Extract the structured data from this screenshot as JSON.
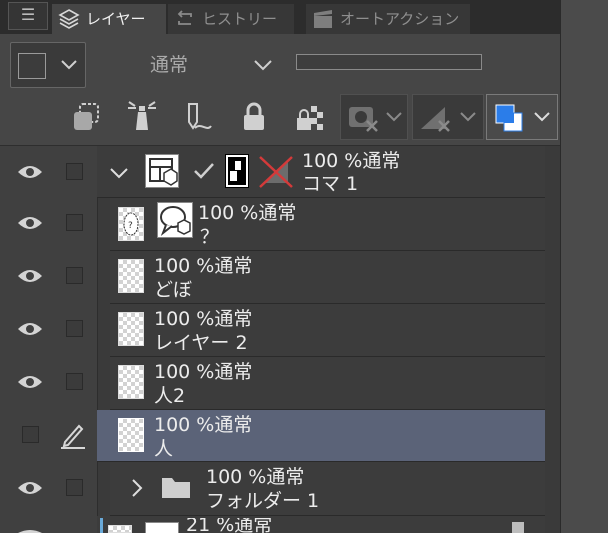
{
  "tabs": [
    {
      "label": "レイヤー",
      "icon": "layers-icon"
    },
    {
      "label": "ヒストリー",
      "icon": "history-icon"
    },
    {
      "label": "オートアクション",
      "icon": "auto-action-icon"
    }
  ],
  "menu_icon": "hamburger-menu-icon",
  "blend_mode": "通常",
  "toolbar_icons": [
    "clipping-icon",
    "reference-layer-icon",
    "draft-layer-icon",
    "lock-icon",
    "lock-transparency-icon",
    "mask-menu-icon",
    "ruler-menu-icon",
    "layer-color-icon"
  ],
  "layer_color": "#2b7de9",
  "layers": [
    {
      "opacity": "100 %",
      "mode": "通常",
      "name": "コマ 1",
      "type": "frame-folder",
      "visible": true,
      "expanded": true
    },
    {
      "opacity": "100 %",
      "mode": "通常",
      "name": "？",
      "type": "balloon",
      "visible": true
    },
    {
      "opacity": "100 %",
      "mode": "通常",
      "name": "どぼ",
      "type": "raster",
      "visible": true
    },
    {
      "opacity": "100 %",
      "mode": "通常",
      "name": "レイヤー 2",
      "type": "raster",
      "visible": true
    },
    {
      "opacity": "100 %",
      "mode": "通常",
      "name": "人2",
      "type": "raster",
      "visible": true
    },
    {
      "opacity": "100 %",
      "mode": "通常",
      "name": "人",
      "type": "raster",
      "visible": false,
      "selected": true,
      "editing": true
    },
    {
      "opacity": "100 %",
      "mode": "通常",
      "name": "フォルダー 1",
      "type": "folder",
      "visible": true,
      "expanded": false
    },
    {
      "opacity": "21 %",
      "mode": "通常",
      "name": "",
      "type": "raster-partial",
      "visible": true
    }
  ]
}
